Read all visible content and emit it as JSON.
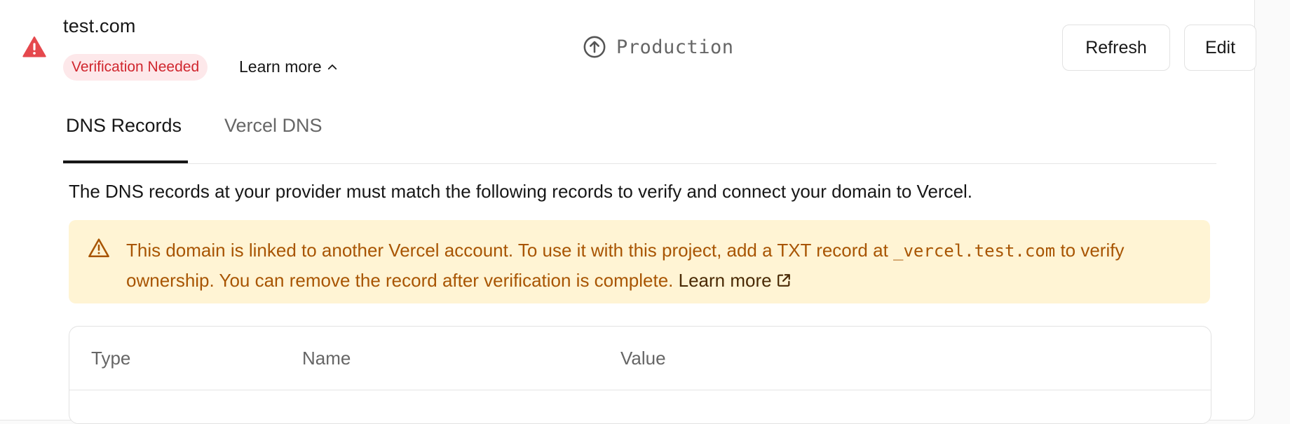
{
  "domain": {
    "name": "test.com",
    "status_badge": "Verification Needed",
    "learn_more_label": "Learn more",
    "environment": "Production"
  },
  "actions": {
    "refresh_label": "Refresh",
    "edit_label": "Edit"
  },
  "tabs": [
    {
      "label": "DNS Records",
      "active": true
    },
    {
      "label": "Vercel DNS",
      "active": false
    }
  ],
  "description": "The DNS records at your provider must match the following records to verify and connect your domain to Vercel.",
  "alert": {
    "text_before": "This domain is linked to another Vercel account. To use it with this project, add a TXT record at ",
    "code": "_vercel.test.com",
    "text_after": " to verify ownership. You can remove the record after verification is complete. ",
    "link_label": "Learn more"
  },
  "table": {
    "columns": [
      "Type",
      "Name",
      "Value"
    ]
  },
  "colors": {
    "error": "#d0262e",
    "badge_bg": "#fde8ea",
    "alert_bg": "#fff4d4",
    "alert_text": "#a85503"
  },
  "icons": {
    "status": "warning-triangle-icon",
    "environment": "arrow-up-circle-icon",
    "toggle": "chevron-up-icon",
    "alert": "warning-triangle-icon",
    "external": "external-link-icon"
  }
}
